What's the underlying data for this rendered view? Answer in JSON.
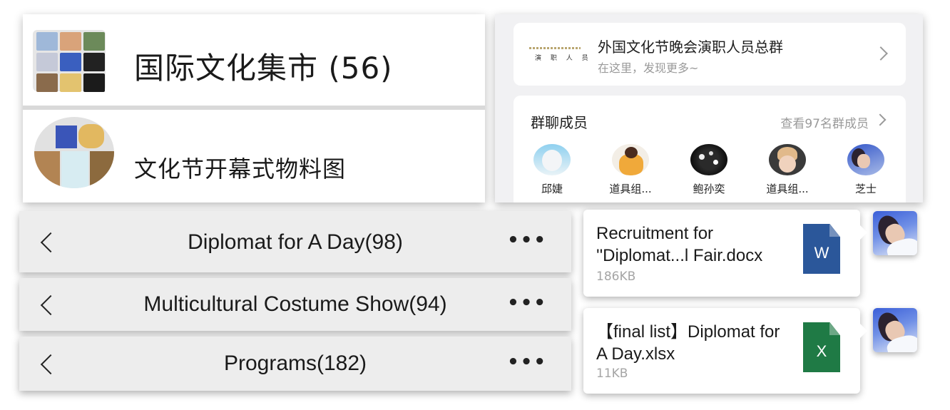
{
  "chat_list": {
    "items": [
      {
        "title": "国际文化集市 (56)",
        "avatar": "group-collage-avatar"
      },
      {
        "title": "文化节开幕式物料图",
        "avatar": "group-collage-avatar"
      }
    ]
  },
  "group_info": {
    "logo_text": "演 职 人 员",
    "group_name": "外国文化节晚会演职人员总群",
    "group_subtitle": "在这里，发现更多~",
    "members_title": "群聊成员",
    "members_link": "查看97名群成员",
    "members": [
      {
        "name": "邱婕"
      },
      {
        "name": "道具组..."
      },
      {
        "name": "鲍孙奕"
      },
      {
        "name": "道具组..."
      },
      {
        "name": "芝士"
      }
    ]
  },
  "chat_headers": [
    {
      "title": "Diplomat for A Day(98)"
    },
    {
      "title": "Multicultural Costume Show(94)"
    },
    {
      "title": "Programs(182)"
    }
  ],
  "icons": {
    "back": "chevron-left-icon",
    "more": "more-dots-icon",
    "forward": "chevron-right-icon"
  },
  "more_glyph": "•••",
  "files": [
    {
      "name": "Recruitment for ''Diplomat...l Fair.docx",
      "size": "186KB",
      "icon_letter": "W",
      "icon_color": "#2b579a",
      "icon": "word-file-icon"
    },
    {
      "name": "【final list】Diplomat for A Day.xlsx",
      "size": "11KB",
      "icon_letter": "X",
      "icon_color": "#1f7a45",
      "icon": "excel-file-icon"
    }
  ]
}
